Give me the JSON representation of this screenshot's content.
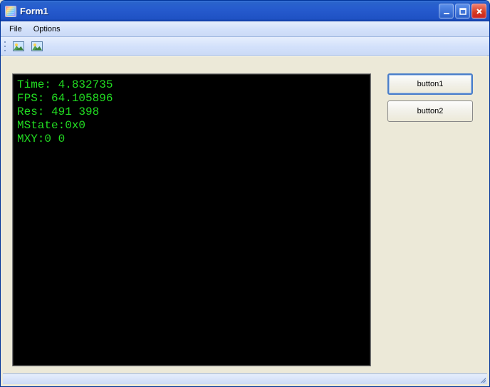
{
  "window": {
    "title": "Form1"
  },
  "menu": {
    "file": "File",
    "options": "Options"
  },
  "toolbar": {
    "icon1": "picture-icon",
    "icon2": "picture-icon"
  },
  "canvas": {
    "lines": {
      "time": "Time: 4.832735",
      "fps": "FPS: 64.105896",
      "res": "Res: 491 398",
      "mstate": "MState:0x0",
      "mxy": "MXY:0 0"
    }
  },
  "buttons": {
    "button1": "button1",
    "button2": "button2"
  },
  "colors": {
    "terminal_fg": "#22dd22",
    "terminal_bg": "#000000"
  }
}
